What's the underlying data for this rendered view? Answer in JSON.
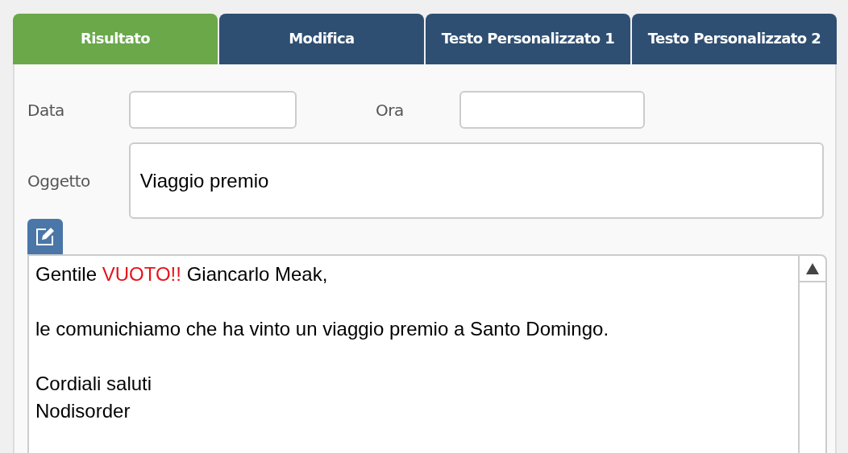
{
  "tabs": [
    {
      "label": "Risultato",
      "selected": true
    },
    {
      "label": "Modifica",
      "selected": false
    },
    {
      "label": "Testo Personalizzato 1",
      "selected": false
    },
    {
      "label": "Testo Personalizzato 2",
      "selected": false
    }
  ],
  "form": {
    "date_label": "Data",
    "time_label": "Ora",
    "subject_label": "Oggetto",
    "subject_value": "Viaggio premio"
  },
  "message": {
    "paragraphs": [
      {
        "lines": [
          [
            {
              "text": "Gentile ",
              "kind": "plain"
            },
            {
              "text": "VUOTO!!",
              "kind": "highlight"
            },
            {
              "text": " Giancarlo Meak,",
              "kind": "plain"
            }
          ]
        ]
      },
      {
        "lines": [
          [
            {
              "text": "le comunichiamo che ha vinto un viaggio premio a Santo Domingo.",
              "kind": "plain"
            }
          ]
        ]
      },
      {
        "lines": [
          [
            {
              "text": "Cordiali saluti",
              "kind": "plain"
            }
          ],
          [
            {
              "text": "Nodisorder",
              "kind": "plain"
            }
          ]
        ]
      }
    ]
  }
}
